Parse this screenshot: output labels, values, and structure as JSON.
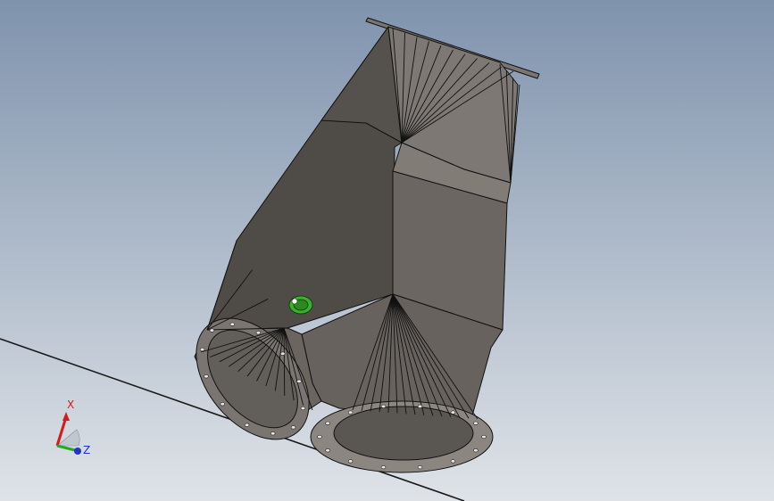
{
  "viewport": {
    "background_top": "#7f93ad",
    "background_bottom": "#dfe3e8"
  },
  "model": {
    "body_light": "#7a7570",
    "body_mid": "#65605b",
    "body_dark": "#4f4c47",
    "edge_color": "#111111",
    "hole_color": "#e6e6e6",
    "fitting_color": "#3cb02c"
  },
  "triad": {
    "x_label": "X",
    "z_label": "Z",
    "x_color": "#d11c1c",
    "y_color": "#22aa22",
    "z_color": "#2233cc"
  }
}
